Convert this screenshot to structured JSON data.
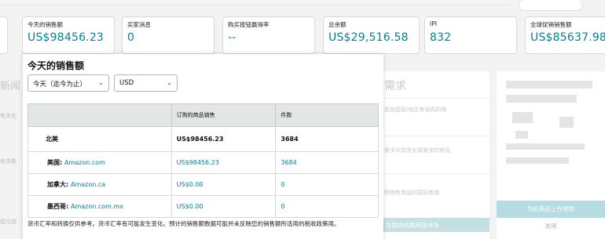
{
  "metrics": [
    {
      "label": "今天的销售额",
      "value": "US$98456.23"
    },
    {
      "label": "买家消息",
      "value": "0"
    },
    {
      "label": "购买按钮赢得率",
      "value": "--"
    },
    {
      "label": "总余额",
      "value": "US$29,516.58"
    },
    {
      "label": "IPI",
      "value": "832"
    },
    {
      "label": "全球促销销售额",
      "value": "US$85637.98"
    }
  ],
  "popover": {
    "title": "今天的销售额",
    "range_select": "今天（迄今为止）",
    "currency_select": "USD",
    "columns": [
      "",
      "订购的商品销售",
      "件数"
    ],
    "total_row": {
      "region": "北美",
      "sales": "US$98456.23",
      "units": "3684"
    },
    "rows": [
      {
        "country": "美国:",
        "site": "Amazon.com",
        "sales": "US$98456.23",
        "units": "3684"
      },
      {
        "country": "加拿大:",
        "site": "Amazon.ca",
        "sales": "US$0.00",
        "units": "0"
      },
      {
        "country": "墨西哥:",
        "site": "Amazon.com.mx",
        "sales": "US$0.00",
        "units": "0"
      }
    ],
    "footnote": "货币汇率和转换仅供参考。货币汇率有可能发生变化。预计的销售额数据可能并未反映您的销售额所适用的税收政策用。"
  },
  "background": {
    "left_title": "新闻",
    "left_rows": [
      "有关在",
      "有关新",
      "程马逊"
    ],
    "mid_title": "需求",
    "mid_rows": [
      "其他国家/地区有很高的需",
      "需求中具有全球需求的商品",
      "畅销售商品的国际商城"
    ],
    "mid_button": "在国内站展商品市场",
    "right_button": "为此商品上传视频",
    "right_close": "关闭"
  }
}
